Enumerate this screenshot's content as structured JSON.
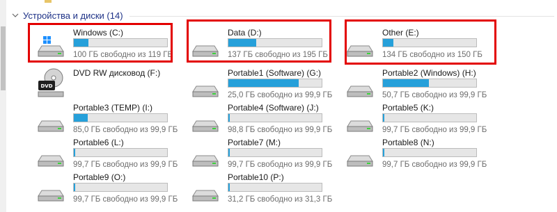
{
  "group": {
    "title": "Устройства и диски (14)"
  },
  "drives": [
    {
      "name": "Windows (C:)",
      "info": "100 ГБ свободно из 119 ГБ",
      "used_fraction": 0.16,
      "icon": "windows-drive-icon"
    },
    {
      "name": "Data (D:)",
      "info": "137 ГБ свободно из 195 ГБ",
      "used_fraction": 0.3,
      "icon": "hard-drive-icon"
    },
    {
      "name": "Other (E:)",
      "info": "134 ГБ свободно из 150 ГБ",
      "used_fraction": 0.11,
      "icon": "hard-drive-icon"
    },
    {
      "name": "DVD RW дисковод (F:)",
      "info": "",
      "used_fraction": null,
      "icon": "dvd-drive-icon"
    },
    {
      "name": "Portable1 (Software) (G:)",
      "info": "25,0 ГБ свободно из 99,9 ГБ",
      "used_fraction": 0.75,
      "icon": "hard-drive-icon"
    },
    {
      "name": "Portable2 (Windows) (H:)",
      "info": "50,7 ГБ свободно из 99,9 ГБ",
      "used_fraction": 0.49,
      "icon": "hard-drive-icon"
    },
    {
      "name": "Portable3 (TEMP) (I:)",
      "info": "85,0 ГБ свободно из 99,9 ГБ",
      "used_fraction": 0.15,
      "icon": "hard-drive-icon"
    },
    {
      "name": "Portable4 (Software) (J:)",
      "info": "98,8 ГБ свободно из 99,9 ГБ",
      "used_fraction": 0.011,
      "icon": "hard-drive-icon"
    },
    {
      "name": "Portable5 (K:)",
      "info": "99,7 ГБ свободно из 99,9 ГБ",
      "used_fraction": 0.002,
      "icon": "hard-drive-icon"
    },
    {
      "name": "Portable6 (L:)",
      "info": "99,7 ГБ свободно из 99,9 ГБ",
      "used_fraction": 0.002,
      "icon": "hard-drive-icon"
    },
    {
      "name": "Portable7 (M:)",
      "info": "99,7 ГБ свободно из 99,9 ГБ",
      "used_fraction": 0.002,
      "icon": "hard-drive-icon"
    },
    {
      "name": "Portable8 (N:)",
      "info": "99,7 ГБ свободно из 99,9 ГБ",
      "used_fraction": 0.002,
      "icon": "hard-drive-icon"
    },
    {
      "name": "Portable9 (O:)",
      "info": "99,7 ГБ свободно из 99,9 ГБ",
      "used_fraction": 0.002,
      "icon": "hard-drive-icon"
    },
    {
      "name": "Portable10 (P:)",
      "info": "31,2 ГБ свободно из 31,3 ГБ",
      "used_fraction": 0.003,
      "icon": "hard-drive-icon"
    }
  ],
  "colors": {
    "bar_fill": "#26a0da",
    "highlight": "#e30000",
    "group_title": "#1e3287"
  }
}
